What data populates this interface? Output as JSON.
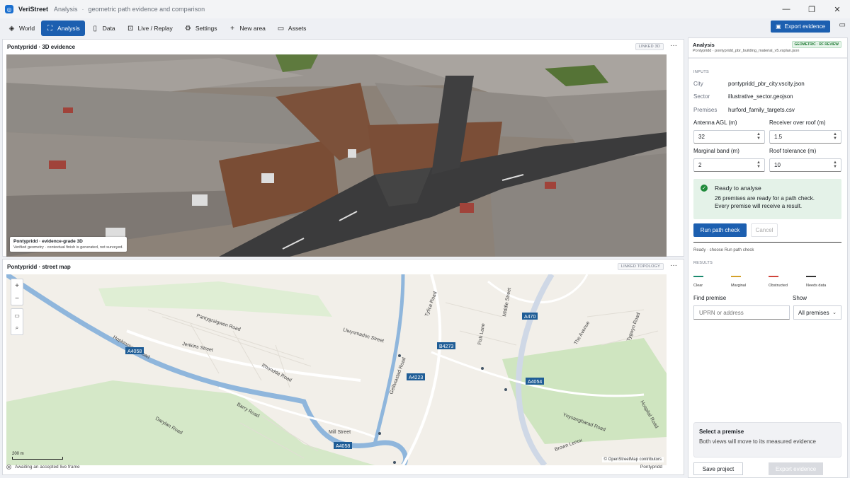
{
  "titlebar": {
    "app_name": "VeriStreet",
    "crumb_section": "Analysis",
    "crumb_page": "geometric path evidence and comparison",
    "minimize": "—",
    "maximize": "❐",
    "close": "✕"
  },
  "toolbar": {
    "tabs": [
      {
        "label": "World",
        "icon": "layers-icon"
      },
      {
        "label": "Analysis",
        "icon": "analysis-icon",
        "active": true
      },
      {
        "label": "Data",
        "icon": "document-icon"
      },
      {
        "label": "Live / Replay",
        "icon": "replay-icon"
      },
      {
        "label": "Settings",
        "icon": "gear-icon"
      },
      {
        "label": "New area",
        "icon": "plus-icon"
      },
      {
        "label": "Assets",
        "icon": "folder-icon"
      }
    ],
    "export_label": "Export evidence"
  },
  "scene_pane": {
    "title": "Pontypridd · 3D evidence",
    "chip": "LINKED 3D",
    "overlay_title": "Pontypridd · evidence-grade 3D",
    "overlay_sub": "Verified geometry · contextual finish is generated, not surveyed."
  },
  "map_pane": {
    "title": "Pontypridd · street map",
    "chip": "LINKED TOPOLOGY",
    "scale_label": "200 m",
    "attribution": "© OpenStreetMap contributors",
    "streets": [
      "Pantygraigwen Road",
      "Tyfica Road",
      "Middle Street",
      "Jenkins Street",
      "Llwynmadoc Street",
      "Hopkinstown Road",
      "Rhondda Road",
      "Fish Lane",
      "The Avenue",
      "Tygwyn Road",
      "Gelliwastad Road",
      "Barry Road",
      "Darylan Road",
      "Mill Street",
      "Ynysangharad Road",
      "Hospital Road",
      "Brown Lenox"
    ],
    "road_shields": [
      "A4058",
      "A470",
      "B4273",
      "A4223",
      "A4054",
      "A4058"
    ],
    "status": "Awaiting an accepted live frame",
    "location": "Pontypridd"
  },
  "analysis": {
    "title": "Analysis",
    "subtitle": "Pontypridd · pontypridd_pbr_building_material_v5.vsplan.json",
    "badge": "GEOMETRIC · RF REVIEW",
    "inputs_heading": "INPUTS",
    "inputs": [
      {
        "key": "City",
        "value": "pontypridd_pbr_city.vscity.json"
      },
      {
        "key": "Sector",
        "value": "illustrative_sector.geojson"
      },
      {
        "key": "Premises",
        "value": "hurford_family_targets.csv"
      }
    ],
    "antenna_label": "Antenna AGL (m)",
    "antenna_value": "32",
    "receiver_label": "Receiver over roof (m)",
    "receiver_value": "1.5",
    "marginal_label": "Marginal band (m)",
    "marginal_value": "2",
    "roof_label": "Roof tolerance (m)",
    "roof_value": "10",
    "ready_title": "Ready to analyse",
    "ready_line1": "26 premises are ready for a path check.",
    "ready_line2": "Every premise will receive a result.",
    "run_label": "Run path check",
    "cancel_label": "Cancel",
    "status_line": "Ready · choose Run path check",
    "results_heading": "RESULTS",
    "legend": [
      {
        "label": "Clear",
        "color": "#1a8a6e"
      },
      {
        "label": "Marginal",
        "color": "#d4a12a"
      },
      {
        "label": "Obstructed",
        "color": "#d0443b"
      },
      {
        "label": "Needs data",
        "color": "#333333"
      }
    ],
    "find_label": "Find premise",
    "find_placeholder": "UPRN or address",
    "show_label": "Show",
    "show_value": "All premises",
    "select_title": "Select a premise",
    "select_sub": "Both views will move to its measured evidence",
    "save_label": "Save project",
    "export_label": "Export evidence"
  }
}
